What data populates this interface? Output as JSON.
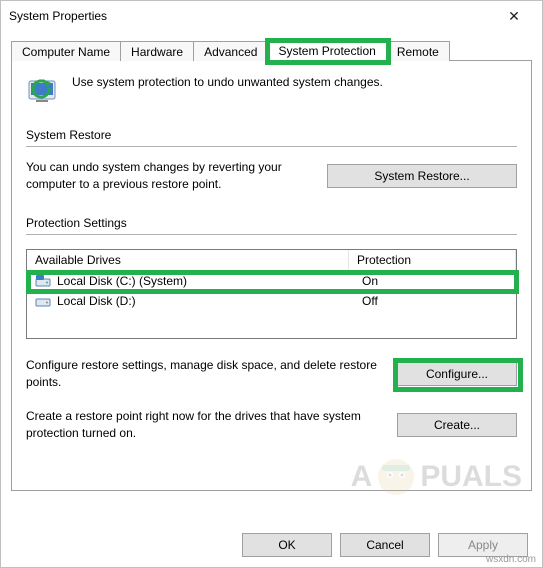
{
  "window": {
    "title": "System Properties",
    "close_glyph": "✕"
  },
  "tabs": [
    {
      "label": "Computer Name",
      "selected": false
    },
    {
      "label": "Hardware",
      "selected": false
    },
    {
      "label": "Advanced",
      "selected": false
    },
    {
      "label": "System Protection",
      "selected": true
    },
    {
      "label": "Remote",
      "selected": false
    }
  ],
  "intro_text": "Use system protection to undo unwanted system changes.",
  "system_restore": {
    "group_label": "System Restore",
    "description": "You can undo system changes by reverting your computer to a previous restore point.",
    "button_label": "System Restore..."
  },
  "protection_settings": {
    "group_label": "Protection Settings",
    "columns": {
      "name": "Available Drives",
      "protection": "Protection"
    },
    "drives": [
      {
        "name": "Local Disk (C:) (System)",
        "protection": "On"
      },
      {
        "name": "Local Disk (D:)",
        "protection": "Off"
      }
    ],
    "configure_text": "Configure restore settings, manage disk space, and delete restore points.",
    "configure_button": "Configure...",
    "create_text": "Create a restore point right now for the drives that have system protection turned on.",
    "create_button": "Create..."
  },
  "dialog": {
    "ok": "OK",
    "cancel": "Cancel",
    "apply": "Apply"
  },
  "watermark": {
    "text": "A   PUALS"
  },
  "footer_mark": "wsxdn.com",
  "colors": {
    "highlight": "#22b14c"
  }
}
